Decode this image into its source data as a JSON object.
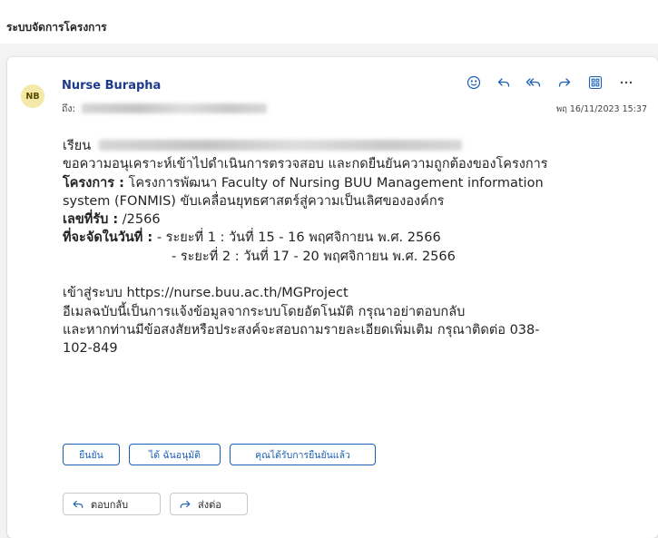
{
  "header": {
    "subject": "ระบบจัดการโครงการ"
  },
  "message": {
    "avatar_initials": "NB",
    "sender": "Nurse Burapha",
    "to_label": "ถึง:",
    "date": "พฤ 16/11/2023 15:37",
    "actions": {
      "emoji_icon": "emoji-icon",
      "reply_icon": "reply-icon",
      "reply_all_icon": "reply-all-icon",
      "forward_icon": "forward-icon",
      "apps_icon": "apps-icon",
      "more_icon": "more-icon"
    },
    "body": {
      "greeting": "เรียน",
      "request": "ขอความอนุเคราะห์เข้าไปดำเนินการตรวจสอบ และกดยืนยันความถูกต้องของโครงการ",
      "project_label": "โครงการ :",
      "project_line1": " โครงการพัฒนา Faculty of Nursing BUU Management information",
      "project_line2": "system (FONMIS) ขับเคลื่อนยุทธศาสตร์สู่ความเป็นเลิศขององค์กร",
      "receipt_label": "เลขที่รับ :",
      "receipt_value": " /2566",
      "date_label": "ที่จะจัดในวันที่ :",
      "phase1": " - ระยะที่ 1 : วันที่ 15 - 16 พฤศจิกายน พ.ศ. 2566",
      "phase2": "- ระยะที่ 2 : วันที่ 17 - 20 พฤศจิกายน พ.ศ. 2566",
      "login_line": "เข้าสู่ระบบ https://nurse.buu.ac.th/MGProject",
      "auto_notice": "อีเมลฉบับนี้เป็นการแจ้งข้อมูลจากระบบโดยอัตโนมัติ กรุณาอย่าตอบกลับ",
      "contact_line1": "และหากท่านมีข้อสงสัยหรือประสงค์จะสอบถามรายละเอียดเพิ่มเติม กรุณาติดต่อ 038-",
      "contact_line2": "102-849"
    },
    "quick_actions": [
      "ยืนยัน",
      "ได้ ฉันอนุมัติ",
      "คุณได้รับการยืนยันแล้ว"
    ],
    "reply_button": "ตอบกลับ",
    "forward_button": "ส่งต่อ"
  },
  "colors": {
    "accent": "#1a5fb4",
    "avatar_bg": "#f5e9a8",
    "sender": "#1b3a8a"
  }
}
